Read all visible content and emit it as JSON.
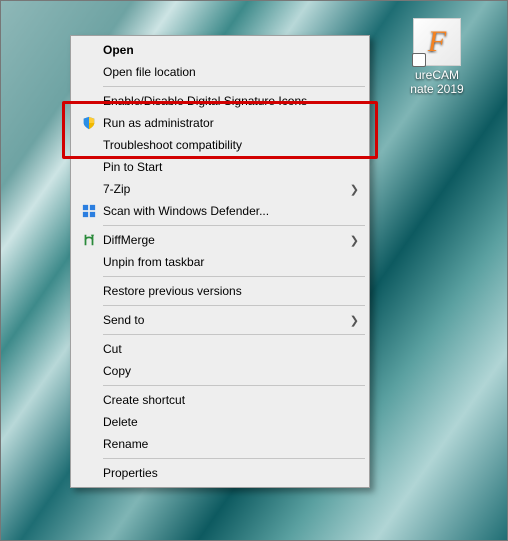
{
  "desktop_icon": {
    "letter": "F",
    "label_line1_partial": "ureCAM",
    "label_line2_partial": "nate 2019"
  },
  "menu": {
    "open": "Open",
    "open_file_location": "Open file location",
    "enable_disable_sig": "Enable/Disable Digital Signature Icons",
    "run_as_admin": "Run as administrator",
    "troubleshoot": "Troubleshoot compatibility",
    "pin_to_start": "Pin to Start",
    "seven_zip": "7-Zip",
    "scan_defender": "Scan with Windows Defender...",
    "diffmerge": "DiffMerge",
    "unpin_taskbar": "Unpin from taskbar",
    "restore_prev": "Restore previous versions",
    "send_to": "Send to",
    "cut": "Cut",
    "copy": "Copy",
    "create_shortcut": "Create shortcut",
    "delete": "Delete",
    "rename": "Rename",
    "properties": "Properties"
  },
  "highlight": {
    "target_item": "run_as_admin"
  }
}
